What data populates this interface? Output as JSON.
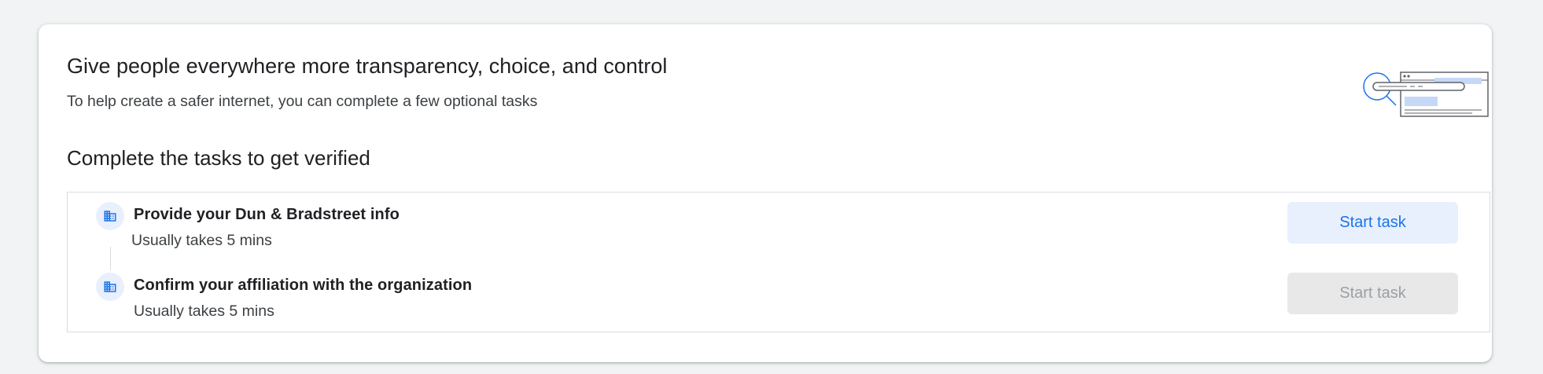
{
  "header": {
    "title": "Give people everywhere more transparency, choice, and control",
    "subtitle": "To help create a safer internet, you can complete a few optional tasks",
    "illustration_icon": "browser-window-illustration"
  },
  "tasks_section": {
    "title": "Complete the tasks to get verified",
    "tasks": [
      {
        "icon": "building-icon",
        "title": "Provide your Dun & Bradstreet info",
        "duration": "Usually takes 5 mins",
        "button_label": "Start task",
        "button_state": "enabled"
      },
      {
        "icon": "building-icon",
        "title": "Confirm your affiliation with the organization",
        "duration": "Usually takes 5 mins",
        "button_label": "Start task",
        "button_state": "disabled"
      }
    ]
  },
  "colors": {
    "accent": "#1a73e8",
    "accent_bg": "#e8f0fe",
    "disabled_bg": "#e8e8e8",
    "disabled_text": "#9aa0a6",
    "page_bg": "#f1f3f4"
  }
}
